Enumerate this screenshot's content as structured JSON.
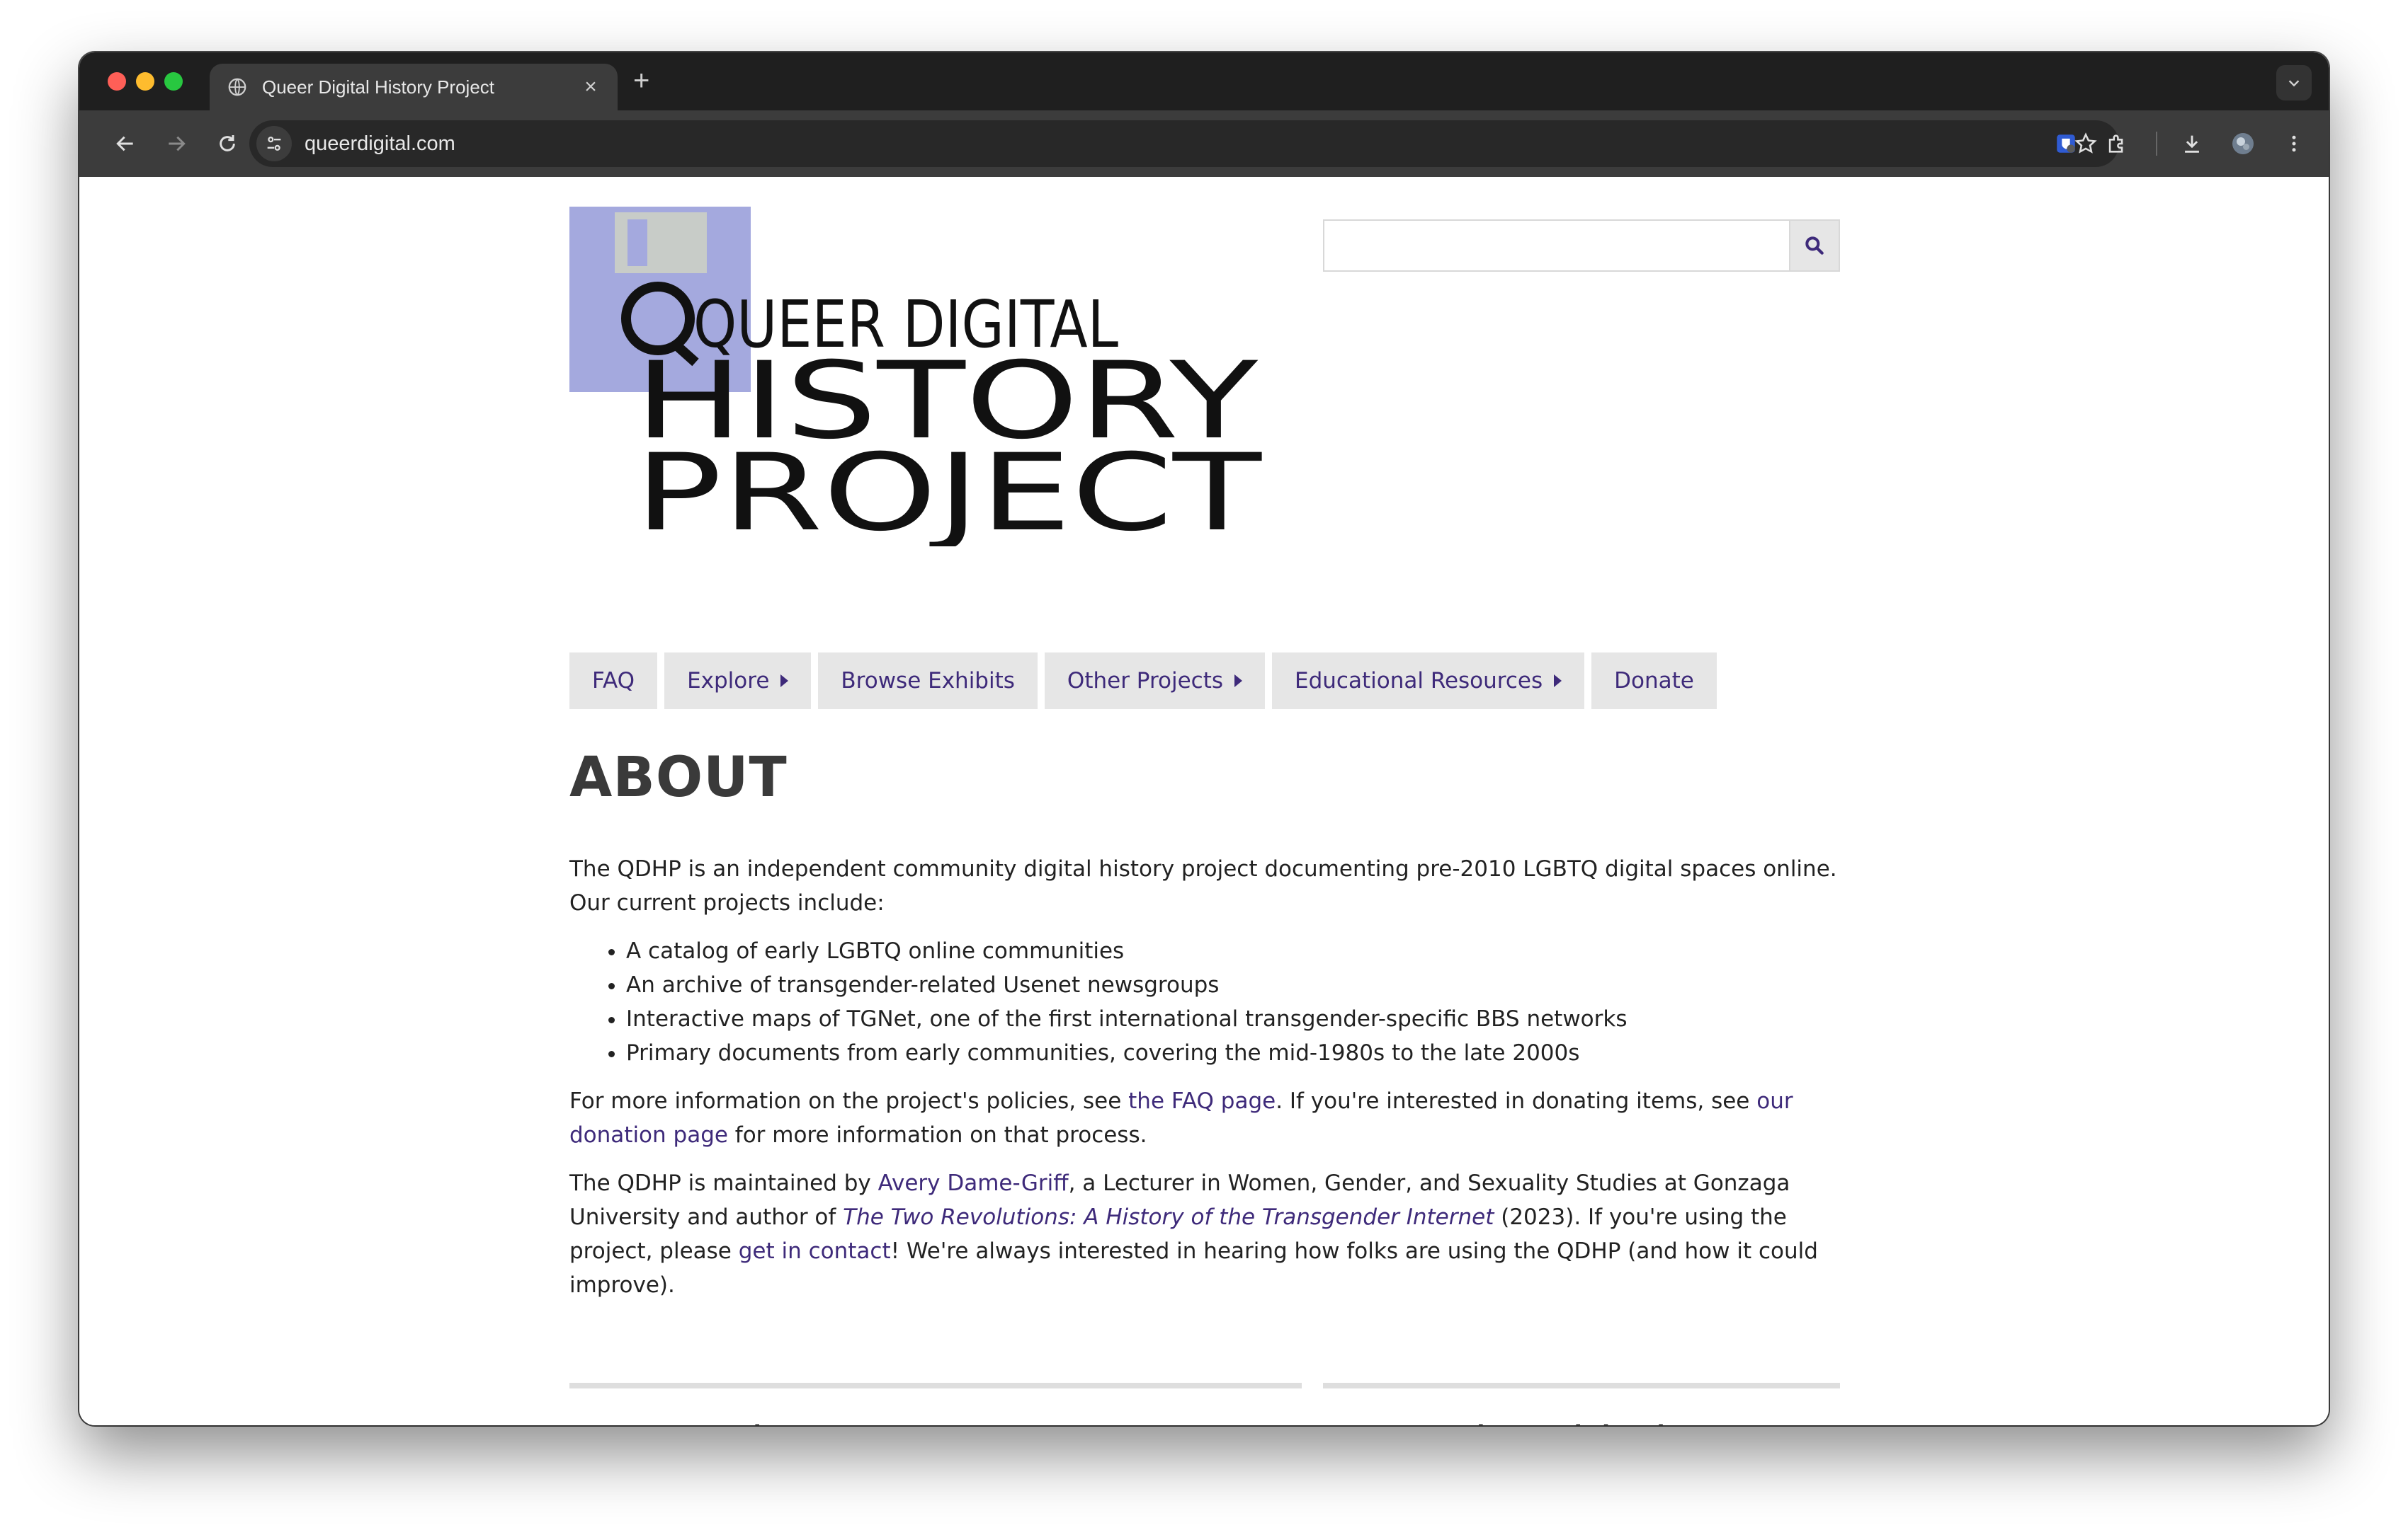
{
  "browser": {
    "tab_title": "Queer Digital History Project",
    "tab_close": "×",
    "new_tab": "+",
    "url": "queerdigital.com"
  },
  "logo": {
    "line1": "QUEER DIGITAL",
    "line2": "HISTORY",
    "line3": "PROJECT",
    "colors": {
      "disk": "#a4a9de",
      "shutter": "#c8ccc8",
      "text": "#111111"
    }
  },
  "search": {
    "placeholder": "",
    "value": ""
  },
  "nav": [
    {
      "label": "FAQ",
      "has_caret": false
    },
    {
      "label": "Explore",
      "has_caret": true
    },
    {
      "label": "Browse Exhibits",
      "has_caret": false
    },
    {
      "label": "Other Projects",
      "has_caret": true
    },
    {
      "label": "Educational Resources",
      "has_caret": true
    },
    {
      "label": "Donate",
      "has_caret": false
    }
  ],
  "about": {
    "heading": "ABOUT",
    "intro": "The QDHP is an independent community digital history project documenting pre-2010 LGBTQ digital spaces online. Our current projects include:",
    "projects": [
      "A catalog of early LGBTQ online communities",
      "An archive of transgender-related Usenet newsgroups",
      "Interactive maps of TGNet, one of the first international transgender-specific BBS networks",
      "Primary documents from early communities, covering the mid-1980s to the late 2000s"
    ],
    "p2": {
      "t1": "For more information on the project's policies, see ",
      "link1": "the FAQ page",
      "t2": ". If you're interested in donating items, see ",
      "link2": "our donation page",
      "t3": " for more information on that process."
    },
    "p3": {
      "t1": "The QDHP is maintained by ",
      "link1": "Avery Dame-Griff",
      "t2": ", a Lecturer in Women, Gender, and Sexuality Studies at Gonzaga University and author of ",
      "link2": "The Two Revolutions: A History of the Transgender Internet",
      "t3": " (2023). If you're using the project, please ",
      "link3": "get in contact",
      "t4": "! We're always interested in hearing how folks are using the QDHP (and how it could improve)."
    }
  },
  "sections": {
    "featured": "Featured Item",
    "recent": "Recently Added Items"
  },
  "colors": {
    "link": "#3e2a7a",
    "nav_bg": "#e6e6e6",
    "chrome_dark": "#1f1f1f",
    "chrome_toolbar": "#3c3c3c"
  }
}
